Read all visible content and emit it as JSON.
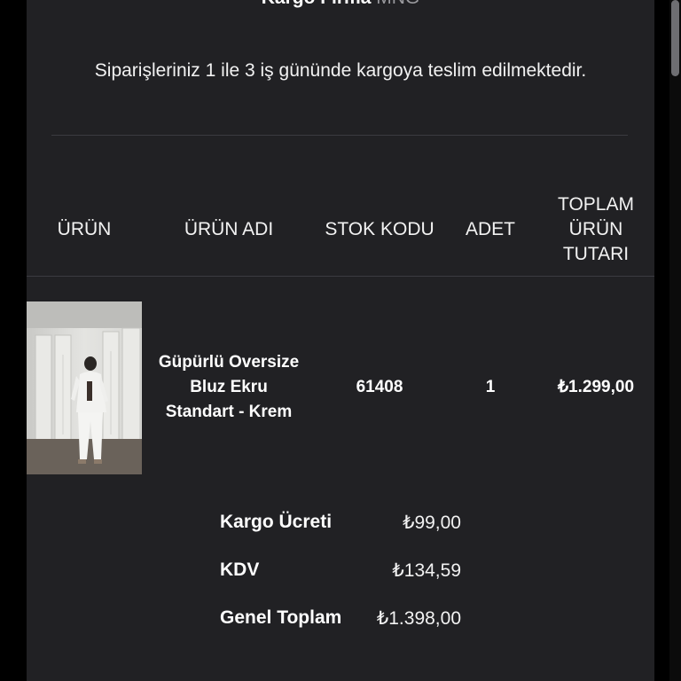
{
  "shipping_header": {
    "label": "Kargo Firma",
    "value": "MNG"
  },
  "info_text": "Siparişleriniz 1 ile 3 iş gününde kargoya teslim edilmektedir.",
  "table": {
    "headers": {
      "product": "ÜRÜN",
      "product_name": "ÜRÜN ADI",
      "stock_code": "STOK KODU",
      "quantity": "ADET",
      "total_line1": "TOPLAM",
      "total_line2": "ÜRÜN",
      "total_line3": "TUTARI"
    },
    "rows": [
      {
        "name_line1": "Güpürlü Oversize",
        "name_line2": "Bluz Ekru",
        "name_line3": "Standart - Krem",
        "stock_code": "61408",
        "quantity": "1",
        "total": "₺1.299,00"
      }
    ]
  },
  "summary": {
    "shipping_label": "Kargo Ücreti",
    "shipping_value": "₺99,00",
    "tax_label": "KDV",
    "tax_value": "₺134,59",
    "grand_label": "Genel Toplam",
    "grand_value": "₺1.398,00"
  }
}
